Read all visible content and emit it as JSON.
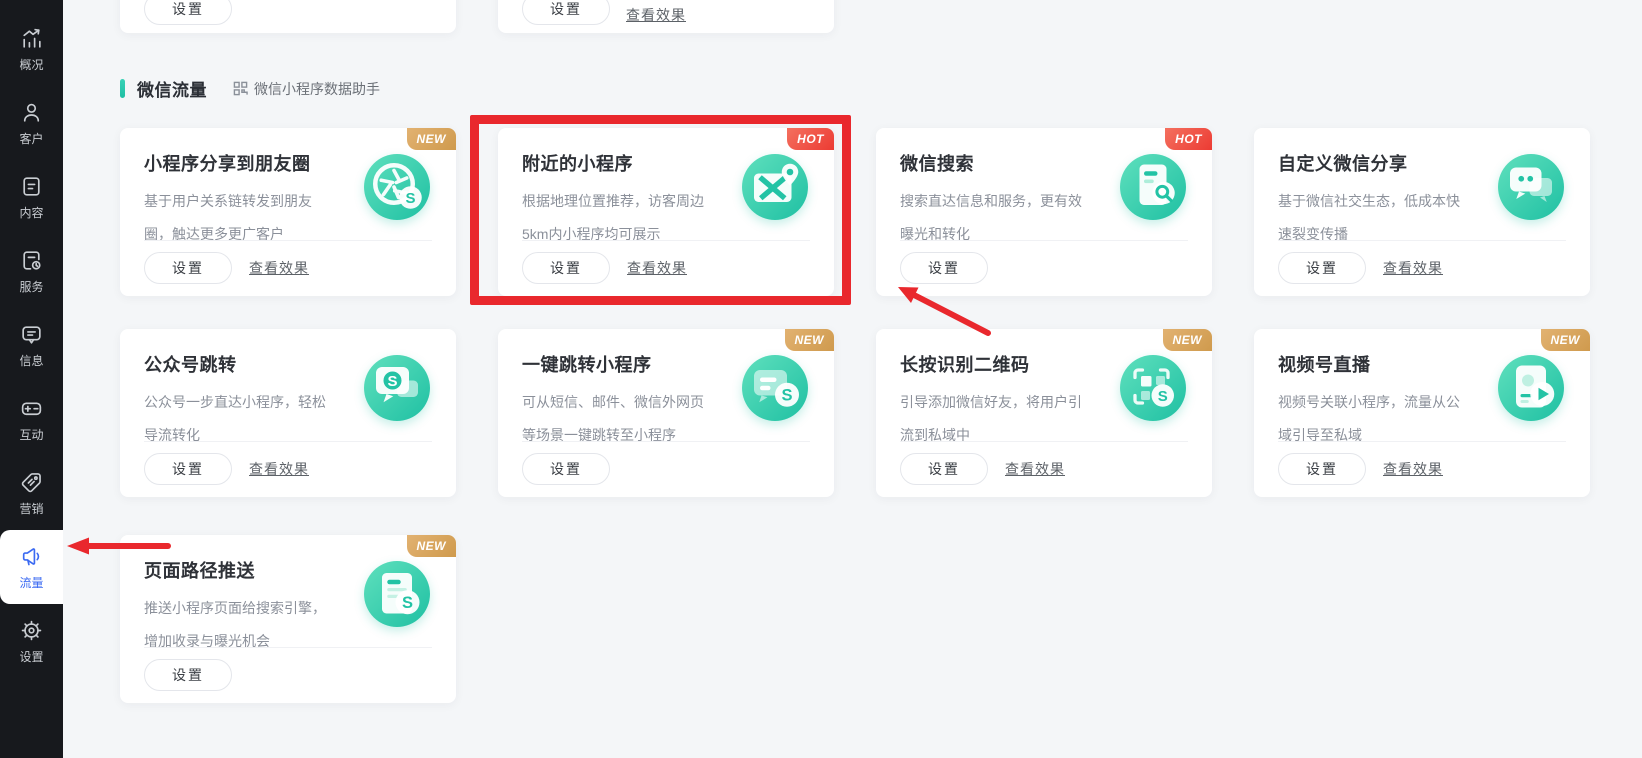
{
  "sidebar": {
    "items": [
      {
        "label": "概况",
        "active": false
      },
      {
        "label": "客户",
        "active": false
      },
      {
        "label": "内容",
        "active": false
      },
      {
        "label": "服务",
        "active": false
      },
      {
        "label": "信息",
        "active": false
      },
      {
        "label": "互动",
        "active": false
      },
      {
        "label": "营销",
        "active": false
      },
      {
        "label": "流量",
        "active": true
      },
      {
        "label": "设置",
        "active": false
      }
    ]
  },
  "header": {
    "title": "微信流量",
    "helper": "微信小程序数据助手"
  },
  "top_cards": [
    {
      "settings_label": "设置"
    },
    {
      "settings_label": "设置",
      "view_label": "查看效果"
    }
  ],
  "cards": [
    {
      "title": "小程序分享到朋友圈",
      "badge": "NEW",
      "desc": "基于用户关系链转发到朋友圈，触达更多更广客户",
      "settings_label": "设置",
      "view_label": "查看效果"
    },
    {
      "title": "附近的小程序",
      "badge": "HOT",
      "highlighted": true,
      "desc": "根据地理位置推荐，访客周边5km内小程序均可展示",
      "settings_label": "设置",
      "view_label": "查看效果"
    },
    {
      "title": "微信搜索",
      "badge": "HOT",
      "desc": "搜索直达信息和服务，更有效曝光和转化",
      "settings_label": "设置"
    },
    {
      "title": "自定义微信分享",
      "desc": "基于微信社交生态，低成本快速裂变传播",
      "settings_label": "设置",
      "view_label": "查看效果"
    },
    {
      "title": "公众号跳转",
      "desc": "公众号一步直达小程序，轻松导流转化",
      "settings_label": "设置",
      "view_label": "查看效果"
    },
    {
      "title": "一键跳转小程序",
      "badge": "NEW",
      "desc": "可从短信、邮件、微信外网页等场景一键跳转至小程序",
      "settings_label": "设置"
    },
    {
      "title": "长按识别二维码",
      "badge": "NEW",
      "desc": "引导添加微信好友，将用户引流到私域中",
      "settings_label": "设置",
      "view_label": "查看效果"
    },
    {
      "title": "视频号直播",
      "badge": "NEW",
      "desc": "视频号关联小程序，流量从公域引导至私域",
      "settings_label": "设置",
      "view_label": "查看效果"
    },
    {
      "title": "页面路径推送",
      "badge": "NEW",
      "desc": "推送小程序页面给搜索引擎，增加收录与曝光机会",
      "settings_label": "设置"
    }
  ],
  "annotations": {
    "highlighted_card": "附近的小程序",
    "arrow_targets": [
      "附近的小程序 card",
      "流量 sidebar item"
    ],
    "red_color": "#e9282d"
  },
  "colors": {
    "sidebar_bg": "#17191d",
    "active_blue": "#3b6af2",
    "accent_teal": "#2dc5ad",
    "icon_gradient": [
      "#5fe0bd",
      "#1fc0a3"
    ],
    "badge_new": "#cf9a4d",
    "badge_hot": "#ec3b33",
    "page_bg": "#f4f6f8"
  }
}
